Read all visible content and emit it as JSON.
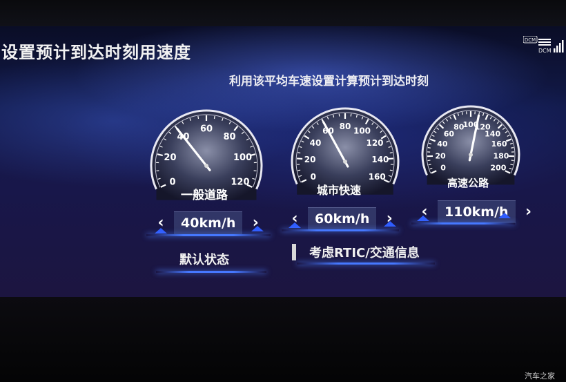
{
  "title": "设置预计到达时刻用速度",
  "subtitle": "利用该平均车速设置计算预计到达时刻",
  "status": {
    "dcm_label": "DCM",
    "dcm_label_2": "DCM"
  },
  "gauges": [
    {
      "name": "一般道路",
      "speed_label": "40km/h",
      "speed": 40,
      "max": 120,
      "ticks": [
        "0",
        "20",
        "40",
        "60",
        "80",
        "100",
        "120"
      ]
    },
    {
      "name": "城市快速",
      "speed_label": "60km/h",
      "speed": 60,
      "max": 180,
      "ticks": [
        "0",
        "20",
        "40",
        "60",
        "80",
        "100",
        "120",
        "140",
        "160"
      ]
    },
    {
      "name": "高速公路",
      "speed_label": "110km/h",
      "speed": 110,
      "max": 200,
      "ticks": [
        "0",
        "20",
        "40",
        "60",
        "80",
        "100",
        "120",
        "140",
        "160",
        "180",
        "200"
      ]
    }
  ],
  "modes": {
    "default_label": "默认状态",
    "rtic_label": "考虑RTIC/交通信息"
  },
  "arrows": {
    "left": "‹",
    "right": "›"
  },
  "watermark": "汽车之家",
  "colors": {
    "accent": "#2f5cff",
    "needle": "#ffffff",
    "text": "#f2f2f2"
  }
}
